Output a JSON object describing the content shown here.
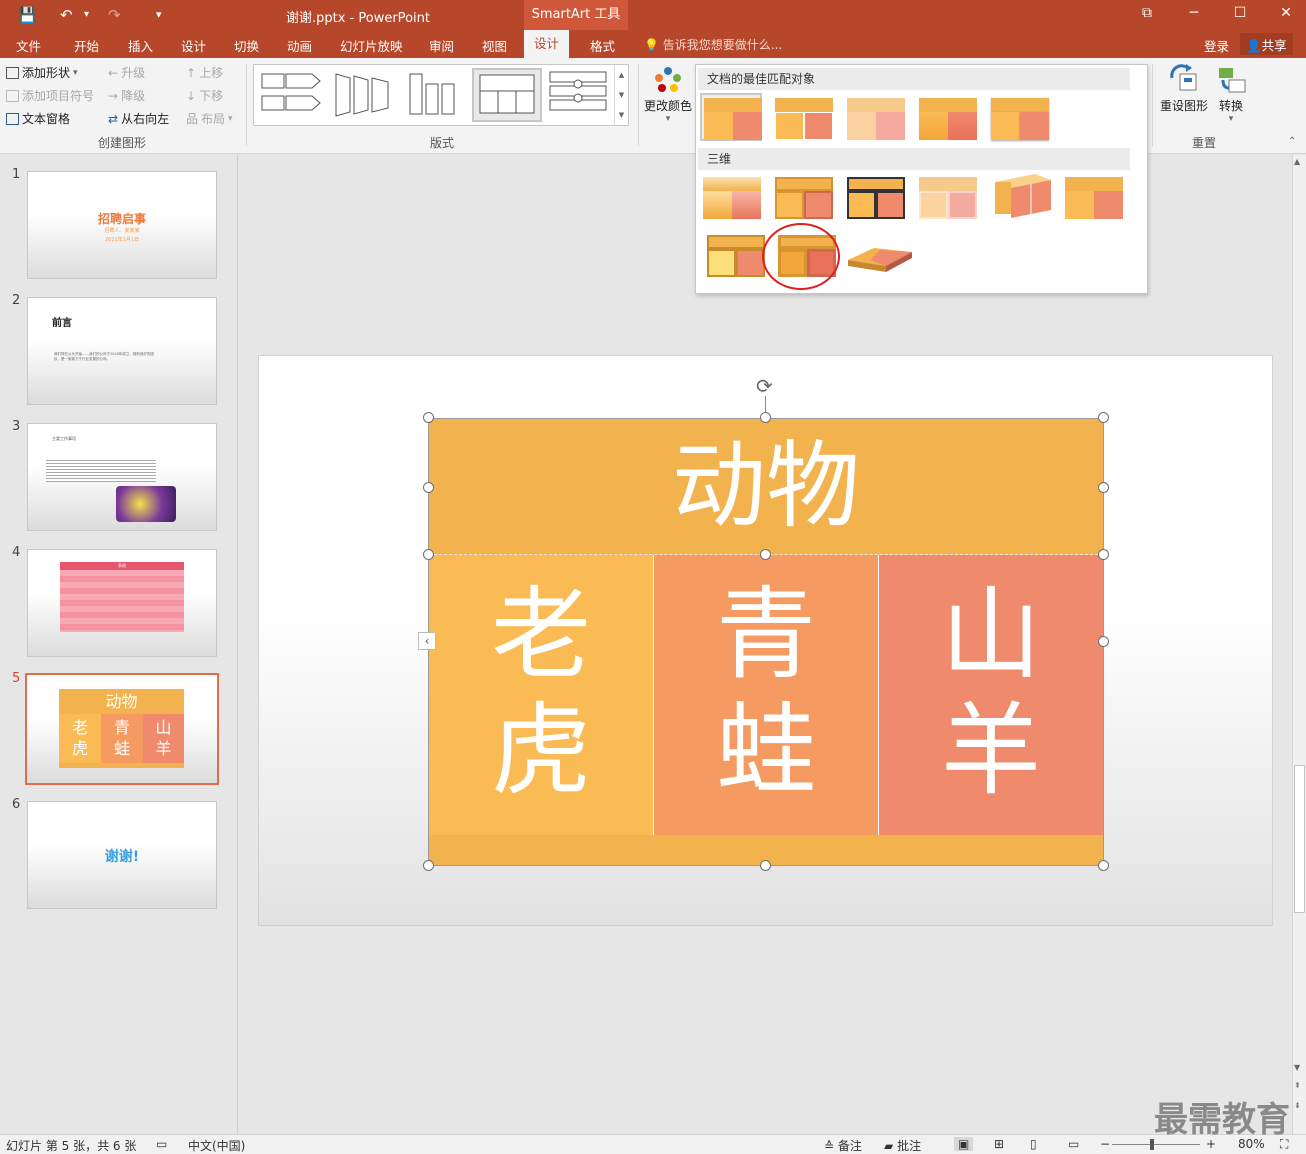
{
  "titlebar": {
    "title": "谢谢.pptx - PowerPoint",
    "context_tool": "SmartArt 工具",
    "save_icon": "💾",
    "undo_icon": "↶",
    "redo_icon": "↷",
    "customize_icon": "▾",
    "restore_icon": "⧉",
    "minimize_icon": "─",
    "maximize_icon": "☐",
    "close_icon": "✕"
  },
  "tabs": [
    "文件",
    "开始",
    "插入",
    "设计",
    "切换",
    "动画",
    "幻灯片放映",
    "审阅",
    "视图",
    "设计",
    "格式"
  ],
  "active_tab_index": 9,
  "tellme": "告诉我您想要做什么...",
  "login": "登录",
  "share": "共享",
  "ribbon": {
    "create_graphic": {
      "add_shape": "添加形状",
      "add_bullet": "添加项目符号",
      "text_pane": "文本窗格",
      "promote": "升级",
      "demote": "降级",
      "right_to_left": "从右向左",
      "move_up": "上移",
      "move_down": "下移",
      "layout": "布局",
      "label": "创建图形"
    },
    "layouts_label": "版式",
    "change_colors": "更改颜色",
    "reset_graphic": "重设图形",
    "convert": "转换",
    "reset_label": "重置"
  },
  "dropdown": {
    "best_match": "文档的最佳匹配对象",
    "three_d": "三维"
  },
  "colors": {
    "orange": "#f2b24e",
    "orange_light": "#fbbb54",
    "salmon": "#f59b62",
    "coral": "#f08a6c",
    "accent_red": "#b7472a"
  },
  "slides": [
    {
      "num": "1",
      "title": "招聘启事",
      "line1": "招聘人：某某某",
      "line2": "2021年1月1日"
    },
    {
      "num": "2",
      "title": "前言",
      "body": "我们现在从头开始……我们的公司于2016年成立，拥有良好的团队，是一家致力于行业发展的公司。"
    },
    {
      "num": "3",
      "title": "主要工作事项"
    },
    {
      "num": "4",
      "table_title": "表格"
    },
    {
      "num": "5",
      "header": "动物",
      "items": [
        "老虎",
        "青蛙",
        "山羊"
      ]
    },
    {
      "num": "6",
      "title": "谢谢!"
    }
  ],
  "smartart": {
    "header": "动物",
    "cells": [
      [
        "老",
        "虎"
      ],
      [
        "青",
        "蛙"
      ],
      [
        "山",
        "羊"
      ]
    ]
  },
  "status": {
    "slide_info": "幻灯片 第 5 张，共 6 张",
    "language": "中文(中国)",
    "notes": "备注",
    "comments": "批注",
    "zoom": "80%"
  },
  "watermark": "最需教育"
}
